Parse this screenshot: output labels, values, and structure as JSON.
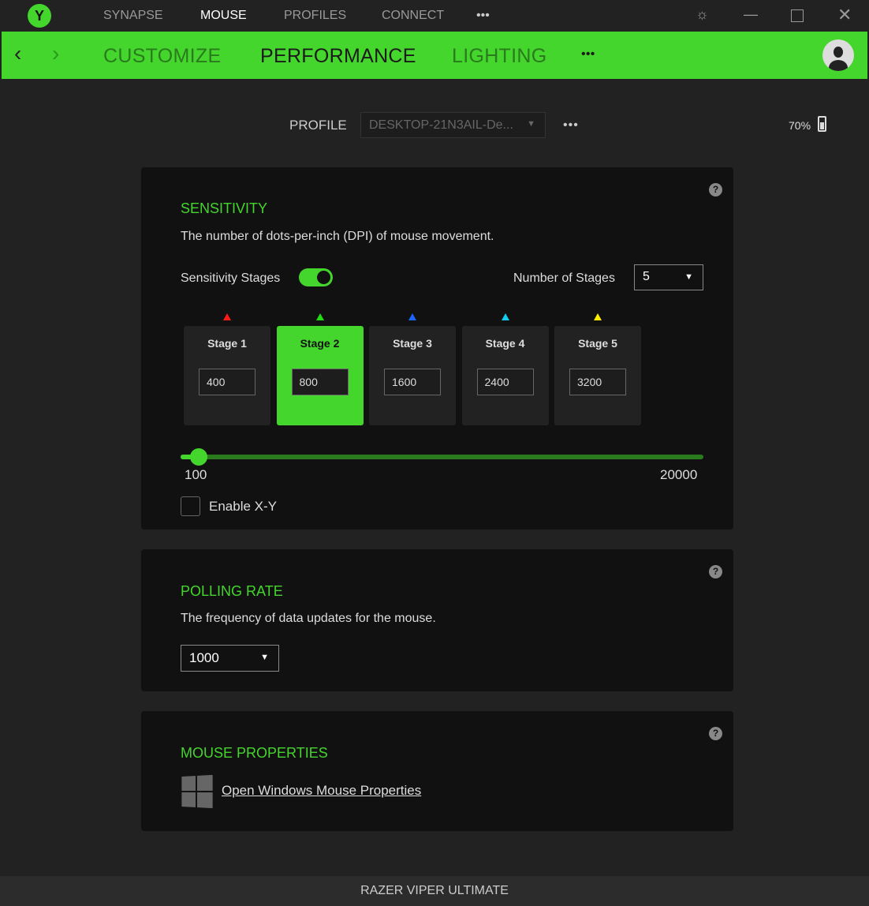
{
  "topnav": {
    "items": [
      "SYNAPSE",
      "MOUSE",
      "PROFILES",
      "CONNECT"
    ],
    "active": "MOUSE",
    "more": "•••"
  },
  "subnav": {
    "items": [
      "CUSTOMIZE",
      "PERFORMANCE",
      "LIGHTING"
    ],
    "active": "PERFORMANCE",
    "more": "•••"
  },
  "profile": {
    "label": "PROFILE",
    "value": "DESKTOP-21N3AIL-De...",
    "more": "•••"
  },
  "battery": {
    "text": "70%",
    "level": 70
  },
  "sensitivity": {
    "title": "SENSITIVITY",
    "description": "The number of dots-per-inch (DPI) of mouse movement.",
    "stages_label": "Sensitivity Stages",
    "stages_enabled": true,
    "num_stages_label": "Number of Stages",
    "num_stages": "5",
    "stages": [
      {
        "name": "Stage 1",
        "value": "400",
        "color": "#ff1a1a"
      },
      {
        "name": "Stage 2",
        "value": "800",
        "color": "#22dd11"
      },
      {
        "name": "Stage 3",
        "value": "1600",
        "color": "#1a66ff"
      },
      {
        "name": "Stage 4",
        "value": "2400",
        "color": "#11ccee"
      },
      {
        "name": "Stage 5",
        "value": "3200",
        "color": "#ffee00"
      }
    ],
    "active_stage": 1,
    "slider": {
      "min": "100",
      "max": "20000",
      "value": 800
    },
    "xy_label": "Enable X-Y",
    "xy_enabled": false
  },
  "polling": {
    "title": "POLLING RATE",
    "description": "The frequency of data updates for the mouse.",
    "value": "1000"
  },
  "properties": {
    "title": "MOUSE PROPERTIES",
    "link": "Open Windows Mouse Properties"
  },
  "help": "?",
  "device": "RAZER VIPER ULTIMATE"
}
